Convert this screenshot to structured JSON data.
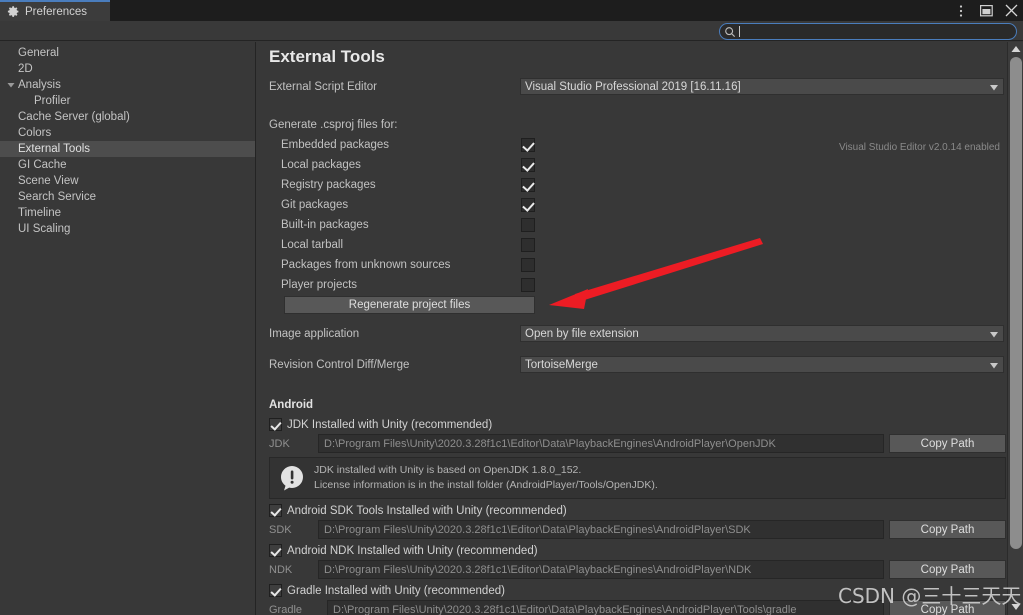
{
  "window": {
    "tab_label": "Preferences",
    "tab_icon": "gear-icon",
    "controls": {
      "menu": "kebab-menu-icon",
      "maximize": "maximize-icon",
      "close": "close-icon"
    }
  },
  "search": {
    "icon": "search-icon",
    "value": "",
    "placeholder": ""
  },
  "sidebar": {
    "items": [
      {
        "label": "General",
        "selected": false,
        "child": false,
        "foldout": ""
      },
      {
        "label": "2D",
        "selected": false,
        "child": false,
        "foldout": ""
      },
      {
        "label": "Analysis",
        "selected": false,
        "child": false,
        "foldout": "expanded"
      },
      {
        "label": "Profiler",
        "selected": false,
        "child": true,
        "foldout": ""
      },
      {
        "label": "Cache Server (global)",
        "selected": false,
        "child": false,
        "foldout": ""
      },
      {
        "label": "Colors",
        "selected": false,
        "child": false,
        "foldout": ""
      },
      {
        "label": "External Tools",
        "selected": true,
        "child": false,
        "foldout": ""
      },
      {
        "label": "GI Cache",
        "selected": false,
        "child": false,
        "foldout": ""
      },
      {
        "label": "Scene View",
        "selected": false,
        "child": false,
        "foldout": ""
      },
      {
        "label": "Search Service",
        "selected": false,
        "child": false,
        "foldout": ""
      },
      {
        "label": "Timeline",
        "selected": false,
        "child": false,
        "foldout": ""
      },
      {
        "label": "UI Scaling",
        "selected": false,
        "child": false,
        "foldout": ""
      }
    ]
  },
  "main": {
    "title": "External Tools",
    "script_editor": {
      "label": "External Script Editor",
      "value": "Visual Studio Professional 2019 [16.11.16]",
      "hint": "Visual Studio Editor v2.0.14 enabled"
    },
    "csproj": {
      "label": "Generate .csproj files for:",
      "options": [
        {
          "label": "Embedded packages",
          "checked": true
        },
        {
          "label": "Local packages",
          "checked": true
        },
        {
          "label": "Registry packages",
          "checked": true
        },
        {
          "label": "Git packages",
          "checked": true
        },
        {
          "label": "Built-in packages",
          "checked": false
        },
        {
          "label": "Local tarball",
          "checked": false
        },
        {
          "label": "Packages from unknown sources",
          "checked": false
        },
        {
          "label": "Player projects",
          "checked": false
        }
      ],
      "regenerate_button": "Regenerate project files"
    },
    "image_application": {
      "label": "Image application",
      "value": "Open by file extension"
    },
    "revision_control": {
      "label": "Revision Control Diff/Merge",
      "value": "TortoiseMerge"
    },
    "android": {
      "section_title": "Android",
      "jdk": {
        "toggle_label": "JDK Installed with Unity (recommended)",
        "toggle_checked": true,
        "path_label": "JDK",
        "path_value": "D:\\Program Files\\Unity\\2020.3.28f1c1\\Editor\\Data\\PlaybackEngines\\AndroidPlayer\\OpenJDK",
        "copy_button": "Copy Path",
        "info_icon": "info-bubble-icon",
        "info_line1": "JDK installed with Unity is based on OpenJDK 1.8.0_152.",
        "info_line2": "License information is in the install folder (AndroidPlayer/Tools/OpenJDK)."
      },
      "sdk": {
        "toggle_label": "Android SDK Tools Installed with Unity (recommended)",
        "toggle_checked": true,
        "path_label": "SDK",
        "path_value": "D:\\Program Files\\Unity\\2020.3.28f1c1\\Editor\\Data\\PlaybackEngines\\AndroidPlayer\\SDK",
        "copy_button": "Copy Path"
      },
      "ndk": {
        "toggle_label": "Android NDK Installed with Unity (recommended)",
        "toggle_checked": true,
        "path_label": "NDK",
        "path_value": "D:\\Program Files\\Unity\\2020.3.28f1c1\\Editor\\Data\\PlaybackEngines\\AndroidPlayer\\NDK",
        "copy_button": "Copy Path"
      },
      "gradle": {
        "toggle_label": "Gradle Installed with Unity (recommended)",
        "toggle_checked": true,
        "path_label": "Gradle",
        "path_value": "D:\\Program Files\\Unity\\2020.3.28f1c1\\Editor\\Data\\PlaybackEngines\\AndroidPlayer\\Tools\\gradle",
        "copy_button": "Copy Path"
      }
    }
  },
  "annotation": {
    "arrow_color": "#ed1c24",
    "target": "Regenerate project files"
  },
  "watermark": "CSDN @三十三天天",
  "colors": {
    "background": "#383838",
    "titlebar": "#1d1d1d",
    "selection": "#4d4d4d",
    "accent": "#4a7dbd",
    "annotation_red": "#ed1c24"
  }
}
